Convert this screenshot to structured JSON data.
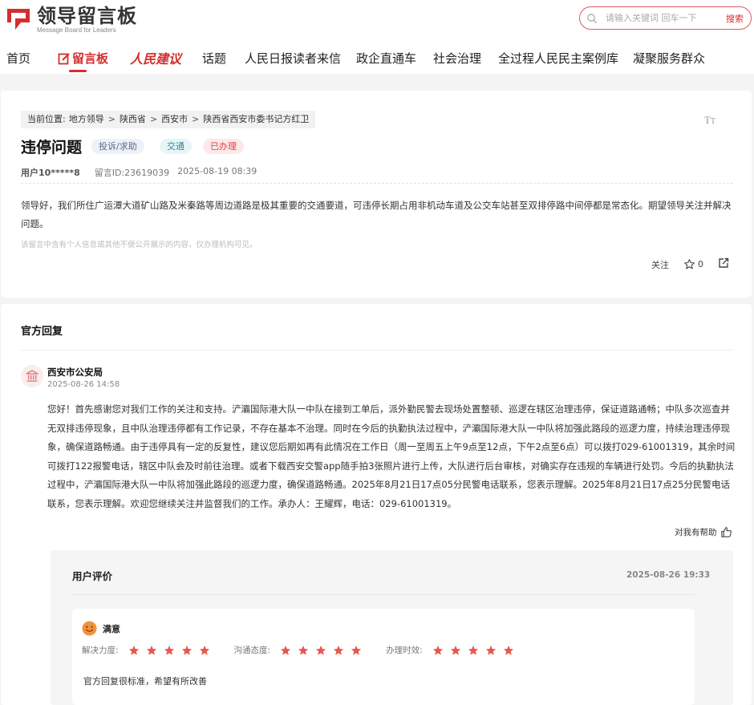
{
  "brand": {
    "title": "领导留言板",
    "subtitle": "Message Board for Leaders",
    "accent": "#d32f2f"
  },
  "search": {
    "placeholder": "请输入关键词 回车一下",
    "button": "搜索"
  },
  "nav": {
    "items": [
      {
        "label": "首页"
      },
      {
        "label": "留言板",
        "active": true
      },
      {
        "label": "人民建议"
      },
      {
        "label": "话题"
      },
      {
        "label": "人民日报读者来信"
      },
      {
        "label": "政企直通车"
      },
      {
        "label": "社会治理"
      },
      {
        "label": "全过程人民民主案例库"
      },
      {
        "label": "凝聚服务群众"
      }
    ]
  },
  "message": {
    "breadcrumb": [
      "当前位置:",
      "地方领导",
      "陕西省",
      "西安市",
      "陕西省西安市委书记方红卫"
    ],
    "font_size_icon": "text-size-icon",
    "title": "违停问题",
    "tags": {
      "type": "投诉/求助",
      "topic": "交通",
      "status": "已办理"
    },
    "user": "用户10*****8",
    "message_id": "留言ID:23619039",
    "time": "2025-08-19 08:39",
    "content": "领导好，我们所住广运潭大道矿山路及米秦路等周边道路是极其重要的交通要道，可违停长期占用非机动车道及公交车站甚至双排停路中间停都是常态化。期望领导关注并解决问题。",
    "privacy_note": "该留言中含有个人信息或其他不便公开展示的内容，仅办理机构可见。",
    "actions": {
      "follow": "关注",
      "likes": "0"
    }
  },
  "reply": {
    "heading": "官方回复",
    "org": "西安市公安局",
    "date": "2025-08-26 14:58",
    "text": "您好！首先感谢您对我们工作的关注和支持。浐灞国际港大队一中队在接到工单后，派外勤民警去现场处置整顿、巡逻在辖区治理违停，保证道路通畅；中队多次巡查并无双排违停现象，且中队治理违停都有工作记录，不存在基本不治理。同时在今后的执勤执法过程中，浐灞国际港大队一中队将加强此路段的巡逻力度，持续治理违停现象，确保道路畅通。由于违停具有一定的反复性，建议您后期如再有此情况在工作日（周一至周五上午9点至12点，下午2点至6点）可以拨打029-61001319，其余时间可拨打122报警电话，辖区中队会及时前往治理。或者下载西安交警app随手拍3张照片进行上传，大队进行后台审核，对确实存在违规的车辆进行处罚。今后的执勤执法过程中，浐灞国际港大队一中队将加强此路段的巡逻力度，确保道路畅通。2025年8月21日17点05分民警电话联系，您表示理解。2025年8月21日17点25分民警电话联系，您表示理解。欢迎您继续关注并监督我们的工作。承办人：王耀辉，电话：029-61001319。",
    "helpful": "对我有帮助"
  },
  "evaluation": {
    "title": "用户评价",
    "time": "2025-08-26 19:33",
    "mood": "满意",
    "ratings": [
      {
        "label": "解决力度:",
        "stars": 5
      },
      {
        "label": "沟通态度:",
        "stars": 5
      },
      {
        "label": "办理时效:",
        "stars": 5
      }
    ],
    "comment": "官方回复很标准，希望有所改善",
    "star_color": "#e8574f"
  }
}
